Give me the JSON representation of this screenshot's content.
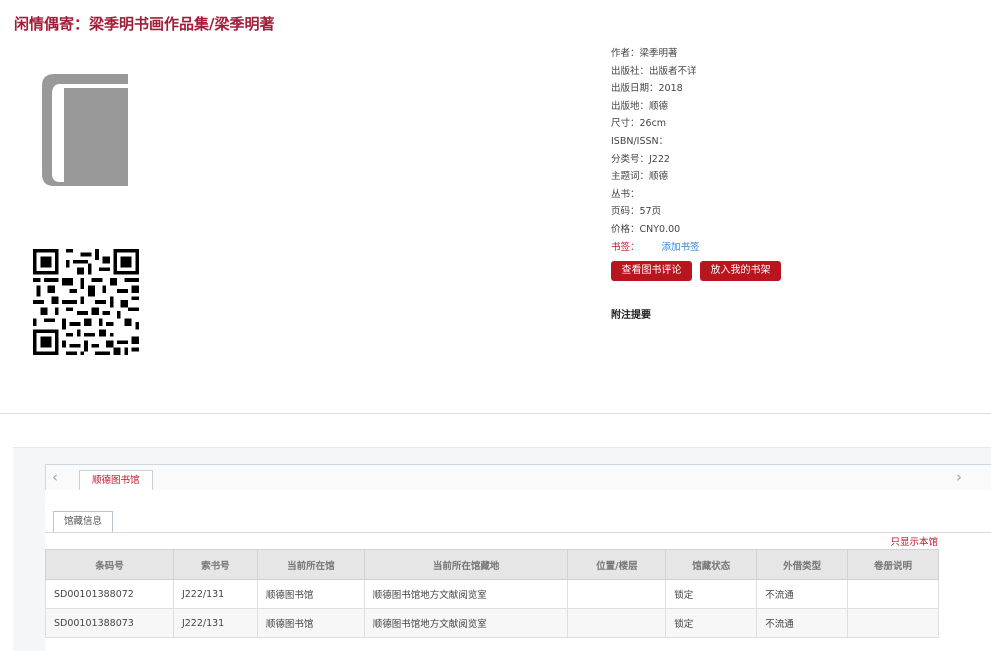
{
  "title": "闲情偶寄：梁季明书画作品集/梁季明著",
  "meta": {
    "author": "作者：梁季明著",
    "publisher": "出版社：出版者不详",
    "pub_date": "出版日期：2018",
    "pub_place": "出版地：顺德",
    "size": "尺寸：26cm",
    "isbn": "ISBN/ISSN：",
    "class_no": "分类号：J222",
    "subject": "主题词：顺德",
    "series": "丛书：",
    "pages": "页码：57页",
    "price": "价格：CNY0.00",
    "bookmark_label": "书签：",
    "bookmark_add": "添加书签"
  },
  "buttons": {
    "view_reviews": "查看图书评论",
    "add_shelf": "放入我的书架"
  },
  "note_heading": "附注提要",
  "holdings": {
    "library_tab": "顺德图书馆",
    "sub_tab": "馆藏信息",
    "only_this_library": "只显示本馆",
    "columns": [
      "条码号",
      "索书号",
      "当前所在馆",
      "当前所在馆藏地",
      "位置/楼层",
      "馆藏状态",
      "外借类型",
      "卷册说明"
    ],
    "rows": [
      {
        "barcode": "SD00101388072",
        "callno": "J222/131",
        "library": "顺德图书馆",
        "location": "顺德图书馆地方文献阅览室",
        "floor": "",
        "status": "锁定",
        "loan_type": "不流通",
        "volume": ""
      },
      {
        "barcode": "SD00101388073",
        "callno": "J222/131",
        "library": "顺德图书馆",
        "location": "顺德图书馆地方文献阅览室",
        "floor": "",
        "status": "锁定",
        "loan_type": "不流通",
        "volume": ""
      }
    ]
  },
  "colors": {
    "title": "#a01e3a",
    "button_bg": "#b8151f",
    "link_blue": "#2f7fd1",
    "accent_red": "#c0162c"
  },
  "icons": {
    "book": "book-icon",
    "qr": "qr-code-icon",
    "prev": "chevron-left-icon",
    "next": "chevron-right-icon"
  }
}
